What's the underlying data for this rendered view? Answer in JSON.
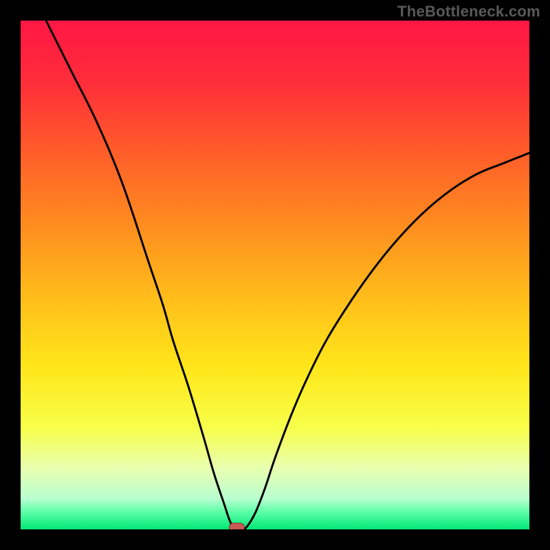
{
  "watermark": "TheBottleneck.com",
  "colors": {
    "frame": "#000000",
    "curve": "#000000",
    "marker_fill": "#c95a54",
    "marker_stroke": "#8a2e28",
    "gradient_stops": [
      {
        "offset": 0.0,
        "color": "#ff1744"
      },
      {
        "offset": 0.12,
        "color": "#ff2d3a"
      },
      {
        "offset": 0.25,
        "color": "#ff5a2a"
      },
      {
        "offset": 0.4,
        "color": "#ff8c1f"
      },
      {
        "offset": 0.55,
        "color": "#ffbf1a"
      },
      {
        "offset": 0.68,
        "color": "#ffe61a"
      },
      {
        "offset": 0.8,
        "color": "#f8ff4a"
      },
      {
        "offset": 0.88,
        "color": "#e8ffb0"
      },
      {
        "offset": 0.94,
        "color": "#b8ffd0"
      },
      {
        "offset": 0.965,
        "color": "#5fffa8"
      },
      {
        "offset": 1.0,
        "color": "#00e876"
      }
    ]
  },
  "chart_data": {
    "type": "line",
    "title": "",
    "xlabel": "",
    "ylabel": "",
    "xlim": [
      0,
      100
    ],
    "ylim": [
      0,
      100
    ],
    "series": [
      {
        "name": "bottleneck-curve",
        "x": [
          5,
          10,
          15,
          20,
          25,
          28,
          30,
          33,
          36,
          38,
          40,
          41,
          42,
          43,
          44,
          46,
          48,
          50,
          53,
          56,
          60,
          65,
          70,
          75,
          80,
          85,
          90,
          95,
          100
        ],
        "values": [
          100,
          90,
          80,
          68,
          53,
          44,
          37,
          28,
          18,
          11,
          5,
          2,
          0,
          0,
          0,
          3,
          8,
          14,
          22,
          29,
          37,
          45,
          52,
          58,
          63,
          67,
          70,
          72,
          74
        ]
      }
    ],
    "flat_bottom": {
      "x_start": 41,
      "x_end": 44,
      "value": 0
    },
    "marker": {
      "x": 42.5,
      "value": 0
    },
    "legend": []
  }
}
